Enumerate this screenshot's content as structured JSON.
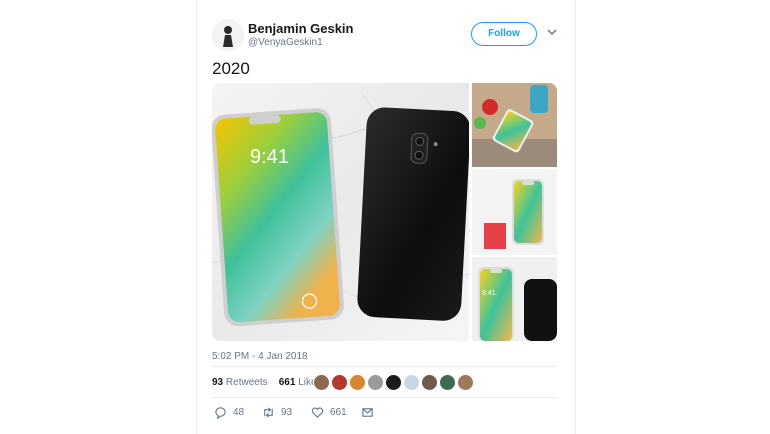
{
  "tweet": {
    "author_name": "Benjamin Geskin",
    "author_handle": "@VenyaGeskin1",
    "follow_label": "Follow",
    "text": "2020",
    "timestamp": "5:02 PM - 4 Jan 2018",
    "phone_time": "9:41",
    "phone_time_small": "9:41"
  },
  "stats": {
    "retweets_count": "93",
    "retweets_label": "Retweets",
    "likes_count": "661",
    "likes_label": "Likes"
  },
  "actions": {
    "reply_count": "48",
    "retweet_count": "93",
    "like_count": "661"
  },
  "colors": {
    "brand": "#1da1f2",
    "muted": "#657786",
    "divider": "#e6ecf0"
  },
  "icons": [
    "chevron-down-icon",
    "reply-icon",
    "retweet-icon",
    "heart-icon",
    "message-icon"
  ]
}
